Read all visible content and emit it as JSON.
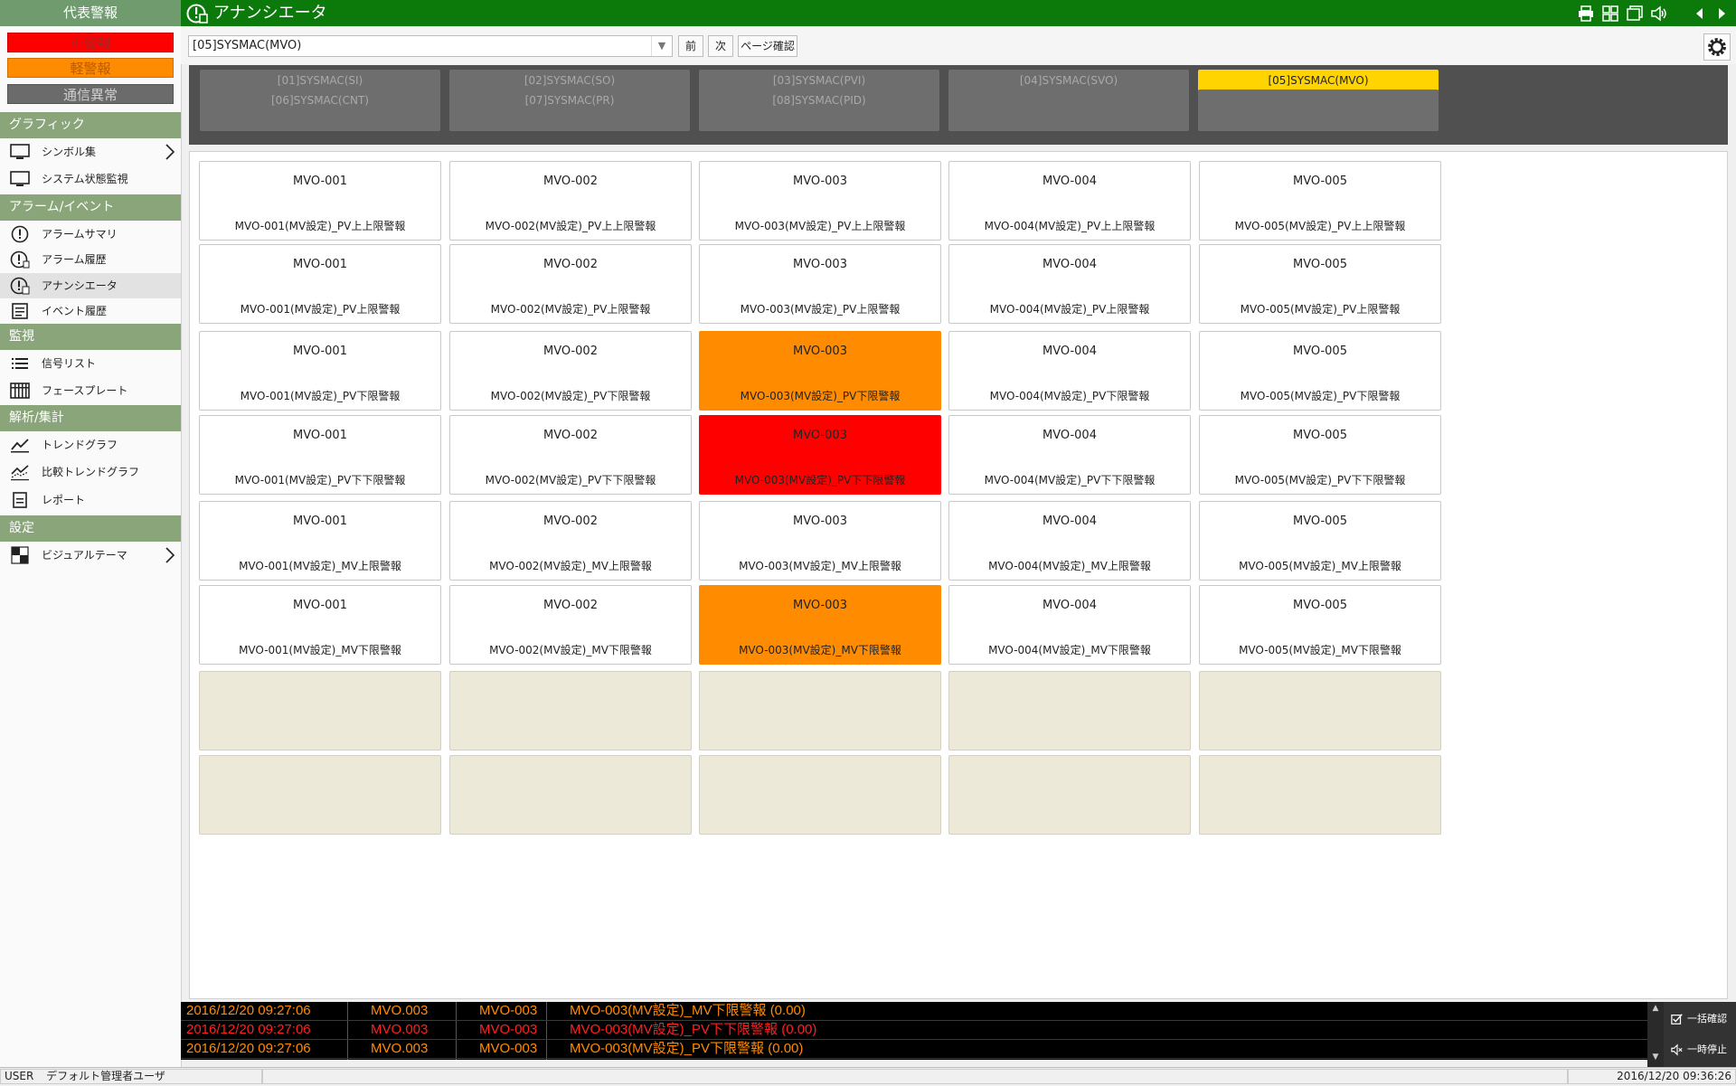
{
  "sidebar": {
    "header": "代表警報",
    "summary": {
      "heavy": "重警報",
      "light": "軽警報",
      "comm": "通信異常"
    },
    "sections": [
      {
        "title": "グラフィック",
        "items": [
          "シンボル集",
          "システム状態監視"
        ]
      },
      {
        "title": "アラーム/イベント",
        "items": [
          "アラームサマリ",
          "アラーム履歴",
          "アナンシエータ",
          "イベント履歴"
        ]
      },
      {
        "title": "監視",
        "items": [
          "信号リスト",
          "フェースプレート"
        ]
      },
      {
        "title": "解析/集計",
        "items": [
          "トレンドグラフ",
          "比較トレンドグラフ",
          "レポート"
        ]
      },
      {
        "title": "設定",
        "items": [
          "ビジュアルテーマ"
        ]
      }
    ]
  },
  "titlebar": {
    "title": "アナンシエータ"
  },
  "toolbar": {
    "page_select": "[05]SYSMAC(MVO)",
    "prev": "前",
    "next": "次",
    "page_confirm": "ページ確認"
  },
  "page_tabs": [
    "[01]SYSMAC(SI)",
    "[02]SYSMAC(SO)",
    "[03]SYSMAC(PVI)",
    "[04]SYSMAC(SVO)",
    "[05]SYSMAC(MVO)",
    "[06]SYSMAC(CNT)",
    "[07]SYSMAC(PR)",
    "[08]SYSMAC(PID)",
    "",
    "",
    "",
    "",
    "",
    "",
    ""
  ],
  "active_tab": 4,
  "grid": {
    "rows": [
      [
        "MVO-001",
        "MVO-002",
        "MVO-003",
        "MVO-004",
        "MVO-005"
      ],
      [
        "MVO-001",
        "MVO-002",
        "MVO-003",
        "MVO-004",
        "MVO-005"
      ],
      [
        "MVO-001",
        "MVO-002",
        "MVO-003",
        "MVO-004",
        "MVO-005"
      ],
      [
        "MVO-001",
        "MVO-002",
        "MVO-003",
        "MVO-004",
        "MVO-005"
      ],
      [
        "MVO-001",
        "MVO-002",
        "MVO-003",
        "MVO-004",
        "MVO-005"
      ],
      [
        "MVO-001",
        "MVO-002",
        "MVO-003",
        "MVO-004",
        "MVO-005"
      ]
    ],
    "messages": [
      "(MV設定)_PV上上限警報",
      "(MV設定)_PV上限警報",
      "(MV設定)_PV下限警報",
      "(MV設定)_PV下下限警報",
      "(MV設定)_MV上限警報",
      "(MV設定)_MV下限警報"
    ],
    "alarm_states": [
      [
        "",
        "",
        "",
        "",
        ""
      ],
      [
        "",
        "",
        "",
        "",
        ""
      ],
      [
        "",
        "",
        "light",
        "",
        ""
      ],
      [
        "",
        "",
        "heavy",
        "",
        ""
      ],
      [
        "",
        "",
        "",
        "",
        ""
      ],
      [
        "",
        "",
        "light",
        "",
        ""
      ]
    ],
    "empty_rows": 2
  },
  "alarm_banner": [
    {
      "time": "2016/12/20 09:27:06",
      "tag": "MVO.003",
      "name": "MVO-003",
      "msg": "MVO-003(MV設定)_MV下限警報 (0.00)",
      "color": "#ff8c00"
    },
    {
      "time": "2016/12/20 09:27:06",
      "tag": "MVO.003",
      "name": "MVO-003",
      "msg": "MVO-003(MV設定)_PV下下限警報 (0.00)",
      "color": "#ff2020"
    },
    {
      "time": "2016/12/20 09:27:06",
      "tag": "MVO.003",
      "name": "MVO-003",
      "msg": "MVO-003(MV設定)_PV下限警報 (0.00)",
      "color": "#ff8c00"
    }
  ],
  "banner_buttons": {
    "ack_all": "一括確認",
    "pause": "一時停止"
  },
  "statusbar": {
    "user_label": "USER",
    "user_name": "デフォルト管理者ユーザ",
    "datetime": "2016/12/20 09:36:26"
  },
  "colors": {
    "heavy": "#ff0000",
    "light": "#ff8c00",
    "titlebar": "#0b7a0b",
    "active_tab": "#ffd400",
    "empty_tile": "#ece9d8"
  }
}
